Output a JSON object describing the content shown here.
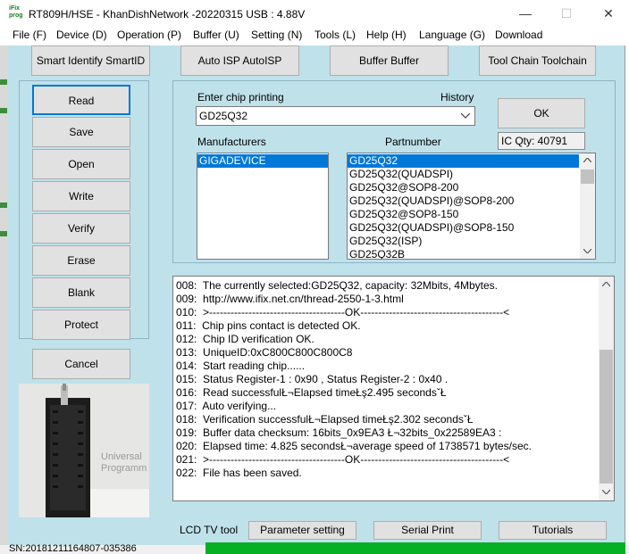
{
  "window": {
    "app_icon_text": "iFix prog",
    "title": "RT809H/HSE - KhanDishNetwork -20220315  USB : 4.88V",
    "minimize_glyph": "—",
    "maximize_glyph": "☐",
    "close_glyph": "✕"
  },
  "menu": [
    "File (F)",
    "Device (D)",
    "Operation (P)",
    "Buffer (U)",
    "Setting (N)",
    "Tools (L)",
    "Help (H)",
    "Language (G)",
    "Download"
  ],
  "toolbar": [
    "Smart Identify SmartID",
    "Auto ISP AutoISP",
    "Buffer Buffer",
    "Tool Chain Toolchain"
  ],
  "side_buttons": [
    "Read",
    "Save",
    "Open",
    "Write",
    "Verify",
    "Erase",
    "Blank",
    "Protect",
    "Cancel"
  ],
  "chip": {
    "label": "Enter chip printing",
    "history_label": "History",
    "value": "GD25Q32",
    "ok_label": "OK",
    "ic_qty": "IC Qty: 40791"
  },
  "manufacturers": {
    "label": "Manufacturers",
    "items": [
      "GIGADEVICE"
    ],
    "selected_index": 0
  },
  "partnumbers": {
    "label": "Partnumber",
    "items": [
      "GD25Q32",
      "GD25Q32(QUADSPI)",
      "GD25Q32@SOP8-200",
      "GD25Q32(QUADSPI)@SOP8-200",
      "GD25Q32@SOP8-150",
      "GD25Q32(QUADSPI)@SOP8-150",
      "GD25Q32(ISP)",
      "GD25Q32B"
    ],
    "selected_index": 0
  },
  "programmer_image": {
    "label": "Universal Programm"
  },
  "log": [
    "008:  The currently selected:GD25Q32, capacity: 32Mbits, 4Mbytes.",
    "009:  http://www.ifix.net.cn/thread-2550-1-3.html",
    "010:  >--------------------------------------OK----------------------------------------<",
    "011:  Chip pins contact is detected OK.",
    "012:  Chip ID verification OK.",
    "013:  UniqueID:0xC800C800C800C8",
    "014:  Start reading chip......",
    "015:  Status Register-1 : 0x90 , Status Register-2 : 0x40 .",
    "016:  Read successfulŁ¬Elapsed timeŁş2.495 secondsˇŁ",
    "017:  Auto verifying...",
    "018:  Verification successfulŁ¬Elapsed timeŁş2.302 secondsˇŁ",
    "019:  Buffer data checksum: 16bits_0x9EA3 Ł¬32bits_0x22589EA3 :",
    "020:  Elapsed time: 4.825 secondsŁ¬average speed of 1738571 bytes/sec.",
    "021:  >--------------------------------------OK----------------------------------------<",
    "022:  File has been saved."
  ],
  "bottom": {
    "lcd_label": "LCD TV tool",
    "buttons": [
      "Parameter setting",
      "Serial Print",
      "Tutorials"
    ]
  },
  "status": {
    "serial": "SN:20181211164807-035386",
    "progress_fraction": 1.0,
    "progress_color": "#06b025"
  },
  "colors": {
    "panel_bg": "#bfe1ea",
    "selection": "#0078d7"
  }
}
